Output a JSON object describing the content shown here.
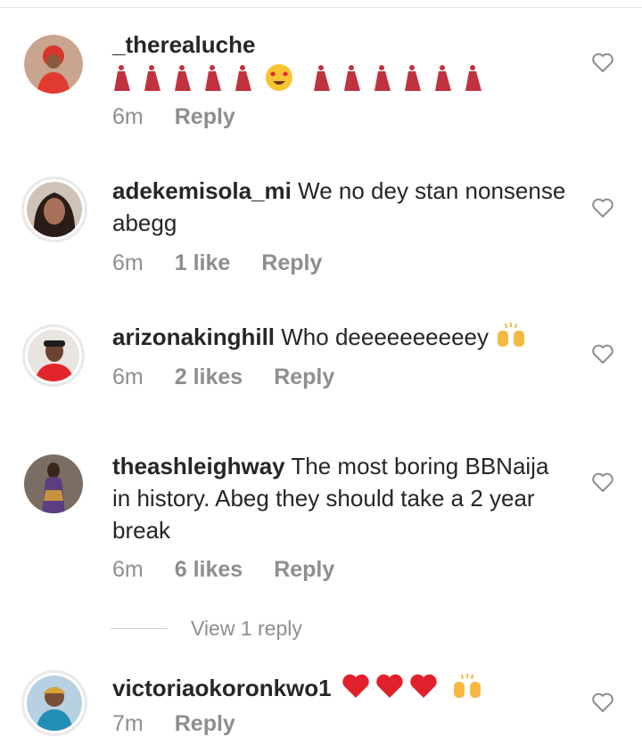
{
  "comments": [
    {
      "username": "_therealuche",
      "text": "",
      "emojis": "dancer x5, heart-eyes, dancer x6",
      "time": "6m",
      "likes": "",
      "reply": "Reply"
    },
    {
      "username": "adekemisola_mi",
      "text": "We no dey stan nonsense abegg",
      "time": "6m",
      "likes": "1 like",
      "reply": "Reply"
    },
    {
      "username": "arizonakinghill",
      "text": "Who deeeeeeeeeey",
      "emojis": "raising-hands",
      "time": "6m",
      "likes": "2 likes",
      "reply": "Reply"
    },
    {
      "username": "theashleighway",
      "text": "The most boring BBNaija in history. Abeg they should take a 2 year break",
      "time": "6m",
      "likes": "6 likes",
      "reply": "Reply"
    },
    {
      "username": "victoriaokoronkwo1",
      "text": "",
      "emojis": "red-heart x3, raising-hands",
      "time": "7m",
      "likes": "",
      "reply": "Reply"
    }
  ],
  "view_replies": "View 1 reply",
  "colors": {
    "text": "#262626",
    "muted": "#8e8e8e",
    "divider": "#e4e4e4"
  }
}
